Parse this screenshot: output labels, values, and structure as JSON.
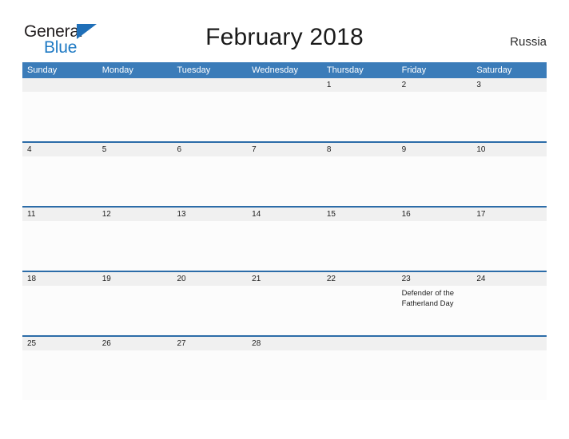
{
  "brand": {
    "name_part1": "General",
    "name_part2": "Blue",
    "flag_icon": "triangle-flag-icon",
    "accent_color": "#1f7ac4"
  },
  "header": {
    "title": "February 2018",
    "country": "Russia"
  },
  "theme": {
    "header_blue": "#3b7cb9",
    "row_border_blue": "#2c6ca8",
    "date_band_gray": "#f0f0f0",
    "cell_background": "#fcfcfc",
    "page_background": "#ffffff",
    "text_color": "#1f1f1f"
  },
  "calendar": {
    "month": "February",
    "year": "2018",
    "weekday_headers": [
      "Sunday",
      "Monday",
      "Tuesday",
      "Wednesday",
      "Thursday",
      "Friday",
      "Saturday"
    ],
    "weeks": [
      [
        {
          "date": "",
          "events": []
        },
        {
          "date": "",
          "events": []
        },
        {
          "date": "",
          "events": []
        },
        {
          "date": "",
          "events": []
        },
        {
          "date": "1",
          "events": []
        },
        {
          "date": "2",
          "events": []
        },
        {
          "date": "3",
          "events": []
        }
      ],
      [
        {
          "date": "4",
          "events": []
        },
        {
          "date": "5",
          "events": []
        },
        {
          "date": "6",
          "events": []
        },
        {
          "date": "7",
          "events": []
        },
        {
          "date": "8",
          "events": []
        },
        {
          "date": "9",
          "events": []
        },
        {
          "date": "10",
          "events": []
        }
      ],
      [
        {
          "date": "11",
          "events": []
        },
        {
          "date": "12",
          "events": []
        },
        {
          "date": "13",
          "events": []
        },
        {
          "date": "14",
          "events": []
        },
        {
          "date": "15",
          "events": []
        },
        {
          "date": "16",
          "events": []
        },
        {
          "date": "17",
          "events": []
        }
      ],
      [
        {
          "date": "18",
          "events": []
        },
        {
          "date": "19",
          "events": []
        },
        {
          "date": "20",
          "events": []
        },
        {
          "date": "21",
          "events": []
        },
        {
          "date": "22",
          "events": []
        },
        {
          "date": "23",
          "events": [
            "Defender of the Fatherland Day"
          ]
        },
        {
          "date": "24",
          "events": []
        }
      ],
      [
        {
          "date": "25",
          "events": []
        },
        {
          "date": "26",
          "events": []
        },
        {
          "date": "27",
          "events": []
        },
        {
          "date": "28",
          "events": []
        },
        {
          "date": "",
          "events": []
        },
        {
          "date": "",
          "events": []
        },
        {
          "date": "",
          "events": []
        }
      ]
    ]
  }
}
